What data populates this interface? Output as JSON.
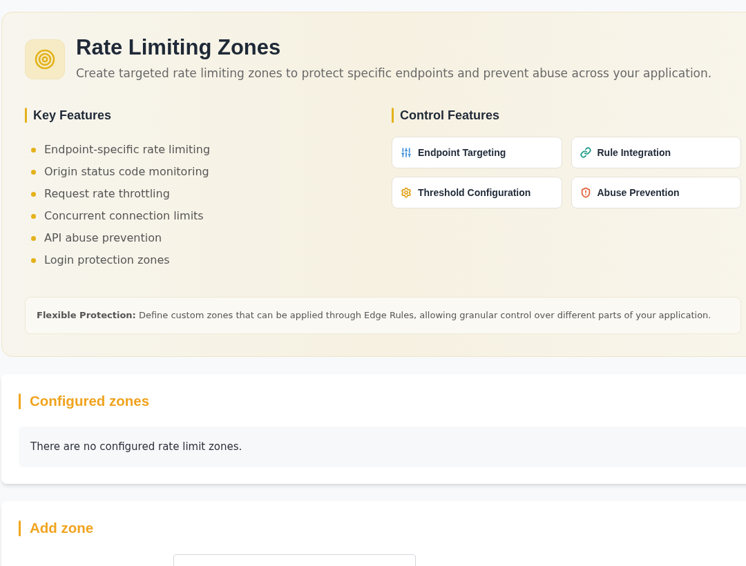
{
  "header": {
    "title": "Rate Limiting Zones",
    "subtitle": "Create targeted rate limiting zones to protect specific endpoints and prevent abuse across your application."
  },
  "key_features": {
    "title": "Key Features",
    "items": [
      "Endpoint-specific rate limiting",
      "Origin status code monitoring",
      "Request rate throttling",
      "Concurrent connection limits",
      "API abuse prevention",
      "Login protection zones"
    ]
  },
  "control_features": {
    "title": "Control Features",
    "items": [
      {
        "label": "Endpoint Targeting",
        "color": "#3b8fd8"
      },
      {
        "label": "Rule Integration",
        "color": "#1a9a86"
      },
      {
        "label": "Threshold Configuration",
        "color": "#e3a21a"
      },
      {
        "label": "Abuse Prevention",
        "color": "#e2623a"
      }
    ]
  },
  "note": "**Flexible Protection:** Define custom zones that can be applied through Edge Rules, allowing granular control over different parts of your application.",
  "configured_zones": {
    "title": "Configured zones",
    "empty_message": "There are no configured rate limit zones."
  },
  "add_zone": {
    "title": "Add zone"
  }
}
